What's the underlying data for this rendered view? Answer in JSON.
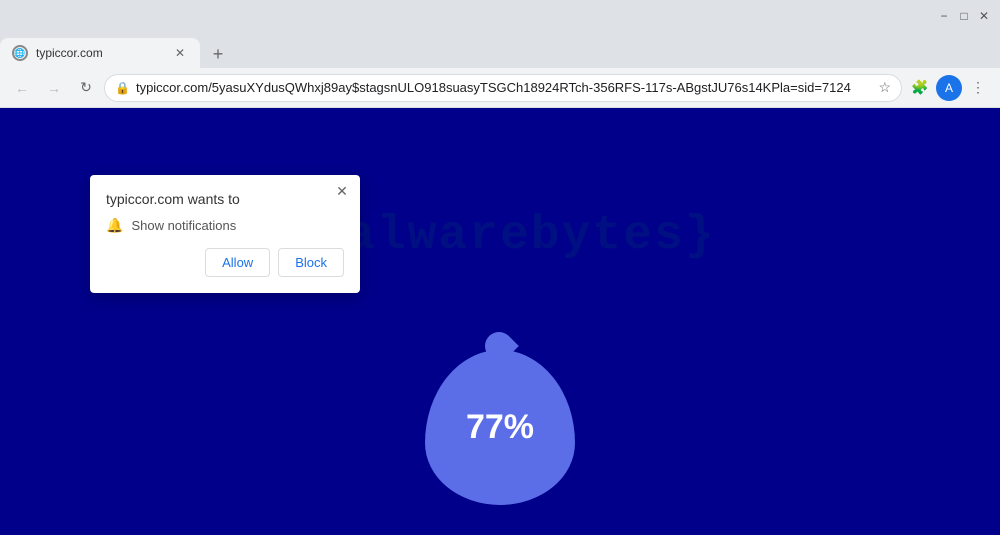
{
  "browser": {
    "title_bar": {
      "minimize_label": "−",
      "maximize_label": "□",
      "close_label": "✕"
    },
    "tab": {
      "globe_icon": "🌐",
      "close_icon": "✕",
      "new_tab_icon": "+"
    },
    "nav": {
      "back_icon": "←",
      "forward_icon": "→",
      "refresh_icon": "↻",
      "url": "typiccor.com/5yasuXYdusQWhxj89ay$stagsnULO918suasyTSGCh18924RTch-356RFS-117s-ABgstJU76s14KPla=sid=7124",
      "lock_icon": "🔒",
      "star_icon": "☆",
      "extensions_icon": "🧩",
      "menu_icon": "⋮"
    },
    "avatar": {
      "initial": "A"
    }
  },
  "page": {
    "background_color": "#00008b",
    "watermark_text": "{malwarebytes}",
    "percentage": "77%"
  },
  "popup": {
    "title": "typiccor.com wants to",
    "close_icon": "✕",
    "option_icon": "🔔",
    "option_label": "Show notifications",
    "allow_label": "Allow",
    "block_label": "Block"
  }
}
